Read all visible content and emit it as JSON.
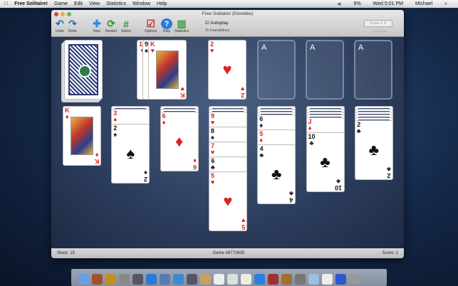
{
  "menubar": {
    "app": "Free Solitaire!",
    "items": [
      "Game",
      "Edit",
      "View",
      "Statistics",
      "Window",
      "Help"
    ],
    "battery": "9%",
    "clock": "Wed 5:01 PM",
    "user": "Michael"
  },
  "window": {
    "title": "Free Solitaire! (Klondike)"
  },
  "toolbar": {
    "undo": "Undo",
    "redo": "Redo",
    "new": "New",
    "restart": "Restart",
    "select": "Select",
    "options": "Options",
    "help": "Help",
    "statistics": "Statistics",
    "autoplay": "Autoplay",
    "autoplay_checked": true,
    "autoplay_sub": "To Foundations",
    "draw": "Draw 3",
    "draw_label": "# to Draw"
  },
  "foundations": [
    "A",
    "A",
    "A"
  ],
  "waste": [
    {
      "rank": "10",
      "suit": "♥"
    },
    {
      "rank": "9",
      "suit": "♠"
    },
    {
      "rank": "K",
      "suit": "♥"
    }
  ],
  "foundation1": {
    "rank": "2",
    "suit": "♥"
  },
  "tableau": [
    {
      "down": 0,
      "up": [
        {
          "rank": "K",
          "suit": "♦"
        }
      ]
    },
    {
      "down": 1,
      "up": [
        {
          "rank": "3",
          "suit": "♦"
        },
        {
          "rank": "2",
          "suit": "♠"
        }
      ]
    },
    {
      "down": 2,
      "up": [
        {
          "rank": "6",
          "suit": "♦"
        }
      ]
    },
    {
      "down": 2,
      "up": [
        {
          "rank": "9",
          "suit": "♥"
        },
        {
          "rank": "8",
          "suit": "♠"
        },
        {
          "rank": "7",
          "suit": "♥"
        },
        {
          "rank": "6",
          "suit": "♣"
        },
        {
          "rank": "5",
          "suit": "♥"
        }
      ]
    },
    {
      "down": 3,
      "up": [
        {
          "rank": "6",
          "suit": "♠"
        },
        {
          "rank": "5",
          "suit": "♦"
        },
        {
          "rank": "4",
          "suit": "♣"
        }
      ]
    },
    {
      "down": 4,
      "up": [
        {
          "rank": "J",
          "suit": "♦"
        },
        {
          "rank": "10",
          "suit": "♣"
        }
      ]
    },
    {
      "down": 5,
      "up": [
        {
          "rank": "2",
          "suit": "♣"
        }
      ]
    }
  ],
  "status": {
    "stock": "Stock: 15",
    "game": "Game #8772605",
    "score": "Score: 2"
  }
}
